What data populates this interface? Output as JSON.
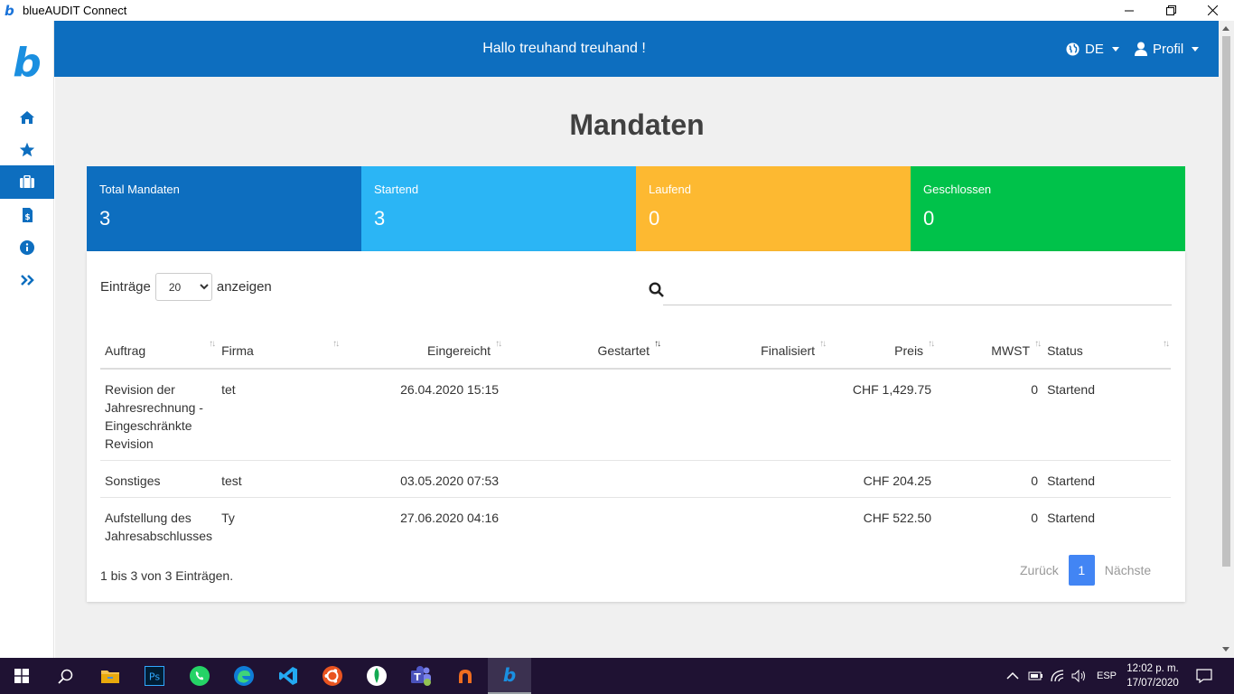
{
  "window": {
    "title": "blueAUDIT Connect",
    "logo_letter": "b"
  },
  "sidebar": {
    "logo_letter": "b",
    "items": [
      {
        "icon": "home-icon"
      },
      {
        "icon": "star-icon"
      },
      {
        "icon": "briefcase-icon",
        "active": true
      },
      {
        "icon": "invoice-icon"
      },
      {
        "icon": "info-icon"
      },
      {
        "icon": "double-chevron-right-icon"
      }
    ]
  },
  "header": {
    "greeting": "Hallo treuhand treuhand !",
    "language": "DE",
    "profile": "Profil"
  },
  "page": {
    "title": "Mandaten"
  },
  "stats": [
    {
      "label": "Total Mandaten",
      "value": "3",
      "color": "#0d6ebf"
    },
    {
      "label": "Startend",
      "value": "3",
      "color": "#2bb5f5"
    },
    {
      "label": "Laufend",
      "value": "0",
      "color": "#fdb931"
    },
    {
      "label": "Geschlossen",
      "value": "0",
      "color": "#00c24a"
    }
  ],
  "table_controls": {
    "entries_prefix": "Einträge",
    "entries_value": "20",
    "entries_suffix": "anzeigen",
    "search_placeholder": ""
  },
  "table": {
    "columns": [
      "Auftrag",
      "Firma",
      "Eingereicht",
      "Gestartet",
      "Finalisiert",
      "Preis",
      "MWST",
      "Status"
    ],
    "rows": [
      {
        "auftrag": "Revision der Jahresrechnung - Eingeschränkte Revision",
        "firma": "tet",
        "eingereicht": "26.04.2020 15:15",
        "gestartet": "",
        "finalisiert": "",
        "preis": "CHF 1,429.75",
        "mwst": "0",
        "status": "Startend"
      },
      {
        "auftrag": "Sonstiges",
        "firma": "test",
        "eingereicht": "03.05.2020 07:53",
        "gestartet": "",
        "finalisiert": "",
        "preis": "CHF 204.25",
        "mwst": "0",
        "status": "Startend"
      },
      {
        "auftrag": "Aufstellung des Jahresabschlusses",
        "firma": "Ty",
        "eingereicht": "27.06.2020 04:16",
        "gestartet": "",
        "finalisiert": "",
        "preis": "CHF 522.50",
        "mwst": "0",
        "status": "Startend"
      }
    ]
  },
  "footer": {
    "info": "1 bis 3 von 3 Einträgen.",
    "prev": "Zurück",
    "page": "1",
    "next": "Nächste"
  },
  "taskbar": {
    "apps": [
      "windows-start-icon",
      "search-icon",
      "file-explorer-icon",
      "photoshop-icon",
      "whatsapp-icon",
      "edge-icon",
      "vscode-icon",
      "ubuntu-icon",
      "mongodb-icon",
      "teams-icon",
      "app-orange-icon",
      "blueaudit-icon"
    ],
    "ps_label": "Ps",
    "language": "ESP",
    "time": "12:02 p. m.",
    "date": "17/07/2020"
  }
}
